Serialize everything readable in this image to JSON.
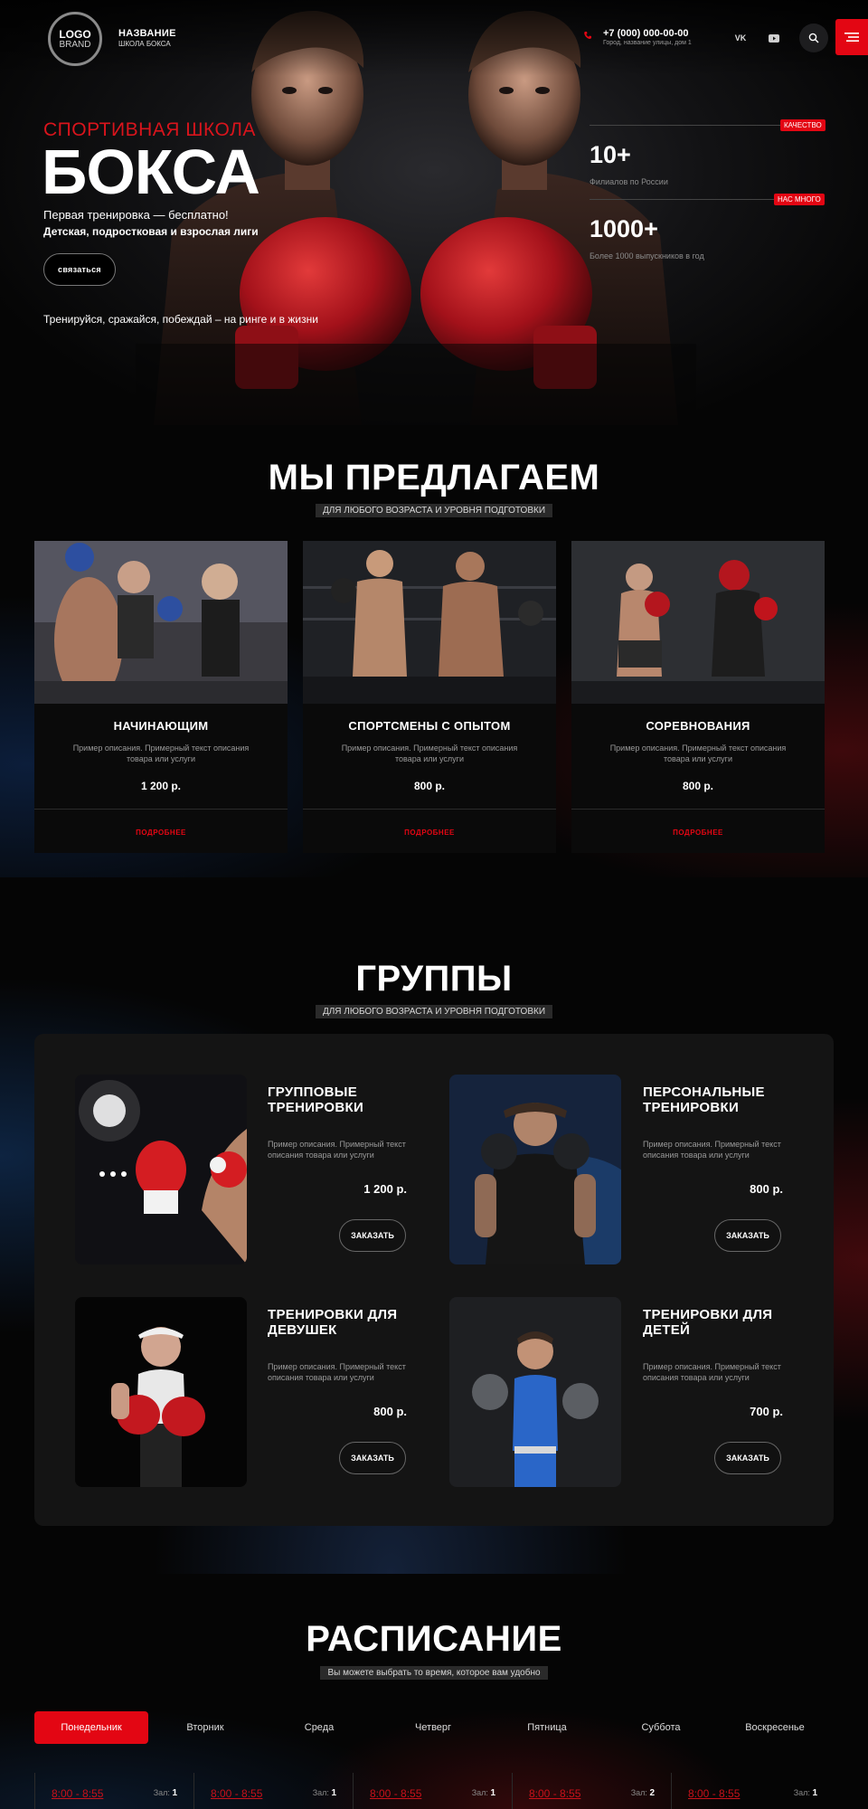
{
  "header": {
    "logo_line1": "LOGO",
    "logo_line2": "BRAND",
    "brand_name": "НАЗВАНИЕ",
    "brand_sub": "ШКОЛА БОКСА",
    "phone": "+7 (000) 000-00-00",
    "address": "Город, название улицы, дом 1",
    "vk_label": "VK"
  },
  "hero": {
    "kicker": "СПОРТИВНАЯ ШКОЛА",
    "title": "БОКСА",
    "line1": "Первая тренировка — бесплатно!",
    "line2": "Детская, подростковая и взрослая лиги",
    "cta": "связаться",
    "tagline": "Тренируйся, сражайся, побеждай – на ринге и в жизни",
    "stats": [
      {
        "badge": "КАЧЕСТВО",
        "value": "10+",
        "desc": "Филиалов по России"
      },
      {
        "badge": "НАС МНОГО",
        "value": "1000+",
        "desc": "Более 1000 выпускников в год"
      }
    ]
  },
  "offer": {
    "title": "МЫ ПРЕДЛАГАЕМ",
    "subtitle": "ДЛЯ ЛЮБОГО ВОЗРАСТА И УРОВНЯ ПОДГОТОВКИ",
    "cards": [
      {
        "name": "НАЧИНАЮЩИМ",
        "desc": "Пример описания. Примерный текст описания товара или услуги",
        "price": "1 200 р.",
        "more": "ПОДРОБНЕЕ"
      },
      {
        "name": "СПОРТСМЕНЫ С ОПЫТОМ",
        "desc": "Пример описания. Примерный текст описания товара или услуги",
        "price": "800 р.",
        "more": "ПОДРОБНЕЕ"
      },
      {
        "name": "СОРЕВНОВАНИЯ",
        "desc": "Пример описания. Примерный текст описания товара или услуги",
        "price": "800 р.",
        "more": "ПОДРОБНЕЕ"
      }
    ]
  },
  "groups": {
    "title": "ГРУППЫ",
    "subtitle": "ДЛЯ ЛЮБОГО ВОЗРАСТА И УРОВНЯ ПОДГОТОВКИ",
    "items": [
      {
        "name": "ГРУППОВЫЕ ТРЕНИРОВКИ",
        "desc": "Пример описания. Примерный текст описания товара или услуги",
        "price": "1 200 р.",
        "order": "ЗАКАЗАТЬ"
      },
      {
        "name": "ПЕРСОНАЛЬНЫЕ ТРЕНИРОВКИ",
        "desc": "Пример описания. Примерный текст описания товара или услуги",
        "price": "800 р.",
        "order": "ЗАКАЗАТЬ"
      },
      {
        "name": "ТРЕНИРОВКИ ДЛЯ ДЕВУШЕК",
        "desc": "Пример описания. Примерный текст описания товара или услуги",
        "price": "800 р.",
        "order": "ЗАКАЗАТЬ"
      },
      {
        "name": "ТРЕНИРОВКИ ДЛЯ ДЕТЕЙ",
        "desc": "Пример описания. Примерный текст описания товара или услуги",
        "price": "700 р.",
        "order": "ЗАКАЗАТЬ"
      }
    ]
  },
  "schedule": {
    "title": "РАСПИСАНИЕ",
    "subtitle": "Вы можете выбрать то время, которое вам удобно",
    "days": [
      "Понедельник",
      "Вторник",
      "Среда",
      "Четверг",
      "Пятница",
      "Суббота",
      "Воскресенье"
    ],
    "active_day": "Понедельник",
    "slots": [
      {
        "time": "8:00 - 8:55",
        "hall_label": "Зал:",
        "hall": "1"
      },
      {
        "time": "8:00 - 8:55",
        "hall_label": "Зал:",
        "hall": "1"
      },
      {
        "time": "8:00 - 8:55",
        "hall_label": "Зал:",
        "hall": "1"
      },
      {
        "time": "8:00 - 8:55",
        "hall_label": "Зал:",
        "hall": "2"
      },
      {
        "time": "8:00 - 8:55",
        "hall_label": "Зал:",
        "hall": "1"
      }
    ]
  },
  "colors": {
    "accent": "#e30613",
    "background": "#050505",
    "panel": "#141414"
  }
}
